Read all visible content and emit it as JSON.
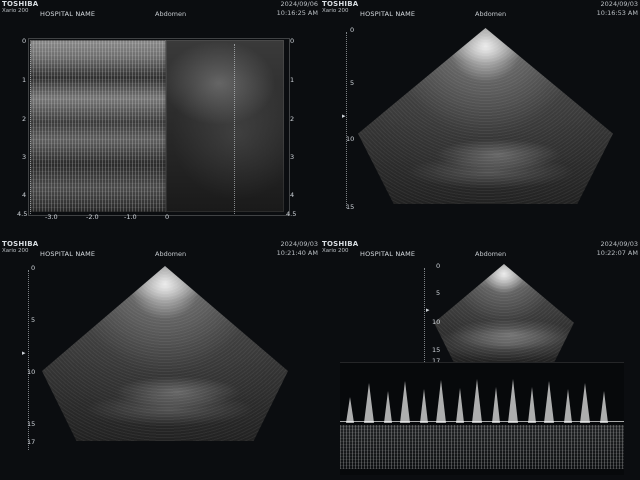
{
  "panels": [
    {
      "logo": "TOSHIBA",
      "model": "Xario 200",
      "hospital": "HOSPITAL NAME",
      "mode": "Abdomen",
      "date": "2024/09/06",
      "time": "10:16:25 AM",
      "left_scale": [
        "0",
        "1",
        "2",
        "3",
        "4",
        "4.5"
      ],
      "right_scale": [
        "0",
        "1",
        "2",
        "3",
        "4",
        "4.5"
      ],
      "x_axis": [
        "-3.0",
        "-2.0",
        "-1.0",
        "0"
      ]
    },
    {
      "logo": "TOSHIBA",
      "model": "Xario 200",
      "hospital": "HOSPITAL NAME",
      "mode": "Abdomen",
      "date": "2024/09/03",
      "time": "10:16:53 AM",
      "depth_scale": [
        "0",
        "5",
        "10",
        "15"
      ]
    },
    {
      "logo": "TOSHIBA",
      "model": "Xario 200",
      "hospital": "HOSPITAL NAME",
      "mode": "Abdomen",
      "date": "2024/09/03",
      "time": "10:21:40 AM",
      "depth_scale": [
        "0",
        "5",
        "10",
        "15",
        "17"
      ]
    },
    {
      "logo": "TOSHIBA",
      "model": "Xario 200",
      "hospital": "HOSPITAL NAME",
      "mode": "Abdomen",
      "date": "2024/09/03",
      "time": "10:22:07 AM",
      "depth_scale": [
        "0",
        "5",
        "10",
        "15",
        "17"
      ]
    }
  ]
}
